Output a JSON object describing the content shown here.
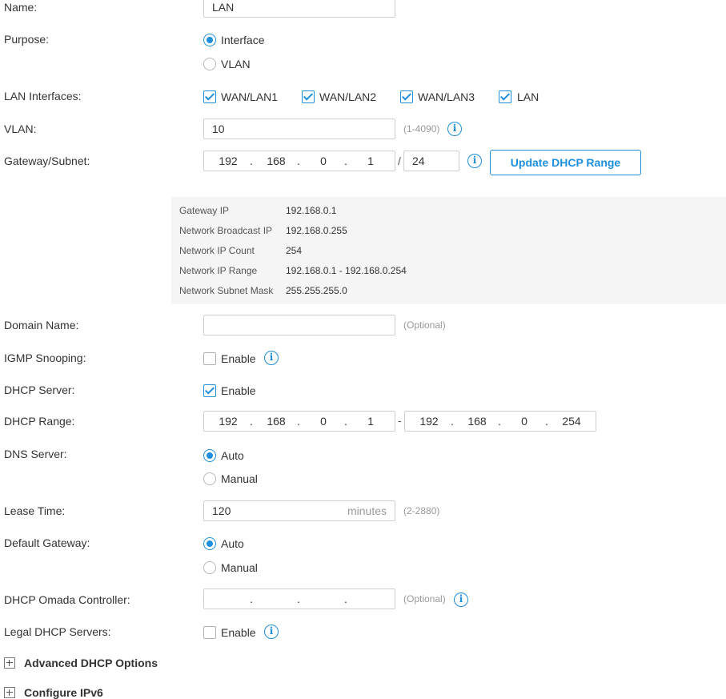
{
  "name": {
    "label": "Name:",
    "value": "LAN"
  },
  "purpose": {
    "label": "Purpose:",
    "options": [
      "Interface",
      "VLAN"
    ],
    "selected": "Interface"
  },
  "lan_interfaces": {
    "label": "LAN Interfaces:",
    "items": [
      {
        "label": "WAN/LAN1",
        "checked": true
      },
      {
        "label": "WAN/LAN2",
        "checked": true
      },
      {
        "label": "WAN/LAN3",
        "checked": true
      },
      {
        "label": "LAN",
        "checked": true
      }
    ]
  },
  "vlan": {
    "label": "VLAN:",
    "value": "10",
    "hint": "(1-4090)"
  },
  "gateway_subnet": {
    "label": "Gateway/Subnet:",
    "octets": [
      "192",
      "168",
      "0",
      "1"
    ],
    "slash": "/",
    "prefix": "24",
    "update_button": "Update DHCP Range"
  },
  "network_info": [
    {
      "key": "Gateway IP",
      "value": "192.168.0.1"
    },
    {
      "key": "Network Broadcast IP",
      "value": "192.168.0.255"
    },
    {
      "key": "Network IP Count",
      "value": "254"
    },
    {
      "key": "Network IP Range",
      "value": "192.168.0.1 - 192.168.0.254"
    },
    {
      "key": "Network Subnet Mask",
      "value": "255.255.255.0"
    }
  ],
  "domain_name": {
    "label": "Domain Name:",
    "value": "",
    "hint": "(Optional)"
  },
  "igmp_snooping": {
    "label": "IGMP Snooping:",
    "option": "Enable",
    "checked": false
  },
  "dhcp_server": {
    "label": "DHCP Server:",
    "option": "Enable",
    "checked": true
  },
  "dhcp_range": {
    "label": "DHCP Range:",
    "start": [
      "192",
      "168",
      "0",
      "1"
    ],
    "dash": "-",
    "end": [
      "192",
      "168",
      "0",
      "254"
    ]
  },
  "dns_server": {
    "label": "DNS Server:",
    "options": [
      "Auto",
      "Manual"
    ],
    "selected": "Auto"
  },
  "lease_time": {
    "label": "Lease Time:",
    "value": "120",
    "unit": "minutes",
    "hint": "(2-2880)"
  },
  "default_gateway": {
    "label": "Default Gateway:",
    "options": [
      "Auto",
      "Manual"
    ],
    "selected": "Auto"
  },
  "omada_controller": {
    "label": "DHCP Omada Controller:",
    "dots": ".",
    "hint": "(Optional)"
  },
  "legal_dhcp_servers": {
    "label": "Legal DHCP Servers:",
    "option": "Enable",
    "checked": false
  },
  "sections": [
    "Advanced DHCP Options",
    "Configure IPv6"
  ],
  "info_icon_glyph": "i",
  "colors": {
    "accent": "#1e8fdc",
    "panel": "#f5f5f5",
    "border": "#cfcfcf"
  }
}
